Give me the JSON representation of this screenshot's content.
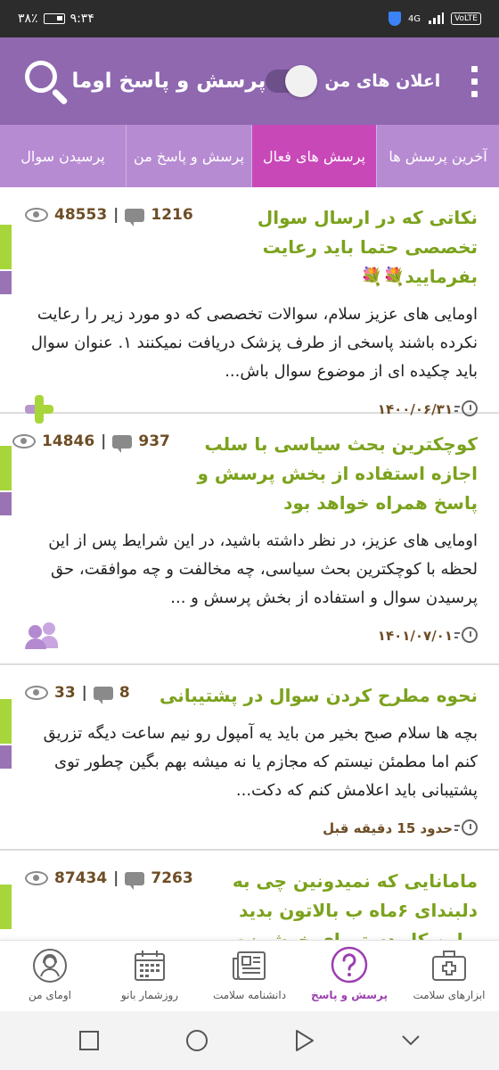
{
  "status": {
    "time": "۹:۳۴",
    "battery": "۳۸٪",
    "network": "4G",
    "volte": "VoLTE"
  },
  "app_bar": {
    "title": "پرسش و پاسخ اوما",
    "toggle_label": "اعلان های من",
    "toggle_on": true
  },
  "tabs": [
    {
      "label": "آخرین پرسش ها",
      "active": false
    },
    {
      "label": "پرسش های فعال",
      "active": true
    },
    {
      "label": "پرسش و پاسخ من",
      "active": false
    },
    {
      "label": "پرسیدن سوال",
      "active": false
    }
  ],
  "questions": [
    {
      "title": "نکاتی که در ارسال سوال تخصصی حتما باید رعایت بفرمایید💐💐",
      "views": "48553",
      "comments": "1216",
      "body": "اومایی های عزیز سلام، سوالات تخصصی که دو مورد زیر را رعایت نکرده باشند پاسخی از طرف پزشک دریافت نمیکنند ۱. عنوان سوال باید چکیده ای از موضوع سوال باش...",
      "date": "۱۴۰۰/۰۶/۳۱",
      "icon": "plus-icon"
    },
    {
      "title": "کوچکترین بحث سیاسی با سلب اجازه استفاده از بخش پرسش و پاسخ همراه خواهد بود",
      "views": "14846",
      "comments": "937",
      "body": "اومایی های عزیز، در نظر داشته باشید، در این شرایط پس از این لحظه با کوچکترین بحث سیاسی، چه مخالفت و چه موافقت، حق پرسیدن سوال و استفاده از بخش پرسش و ...",
      "date": "۱۴۰۱/۰۷/۰۱",
      "icon": "users-icon"
    },
    {
      "title": "نحوه مطرح کردن سوال در پشتیبانی",
      "views": "33",
      "comments": "8",
      "body": "بچه ها سلام صبح بخیر من باید یه آمپول رو نیم ساعت دیگه تزریق کنم اما مطمئن نیستم که مجازم یا نه میشه بهم بگین چطور توی پشتیبانی باید اعلامش کنم که دکت...",
      "date": "حدود 15 دقیقه قبل",
      "icon": "plus-icon"
    },
    {
      "title": "مامانایی که نمیدونین چی به دلبندای ۶ماه ب بالاتون بدید بیاین کل دستورای خوشمزه",
      "views": "87434",
      "comments": "7263",
      "body": "",
      "date": "",
      "icon": "plus-icon"
    }
  ],
  "bottom_nav": [
    {
      "label": "اومای من",
      "icon": "woman-avatar-icon",
      "active": false
    },
    {
      "label": "روزشمار بانو",
      "icon": "calendar-icon",
      "active": false
    },
    {
      "label": "دانشنامه سلامت",
      "icon": "newspaper-icon",
      "active": false
    },
    {
      "label": "پرسش و پاسخ",
      "icon": "question-icon",
      "active": true
    },
    {
      "label": "ابزارهای سلامت",
      "icon": "medical-kit-icon",
      "active": false
    }
  ],
  "colors": {
    "app_bar": "#8f68b0",
    "tabs": "#b78bd2",
    "active_tab": "#c948b8",
    "title_green": "#7ba21c",
    "stat_brown": "#6e4d25",
    "accent_green": "#a7d63a",
    "accent_purple": "#9a73b5"
  }
}
